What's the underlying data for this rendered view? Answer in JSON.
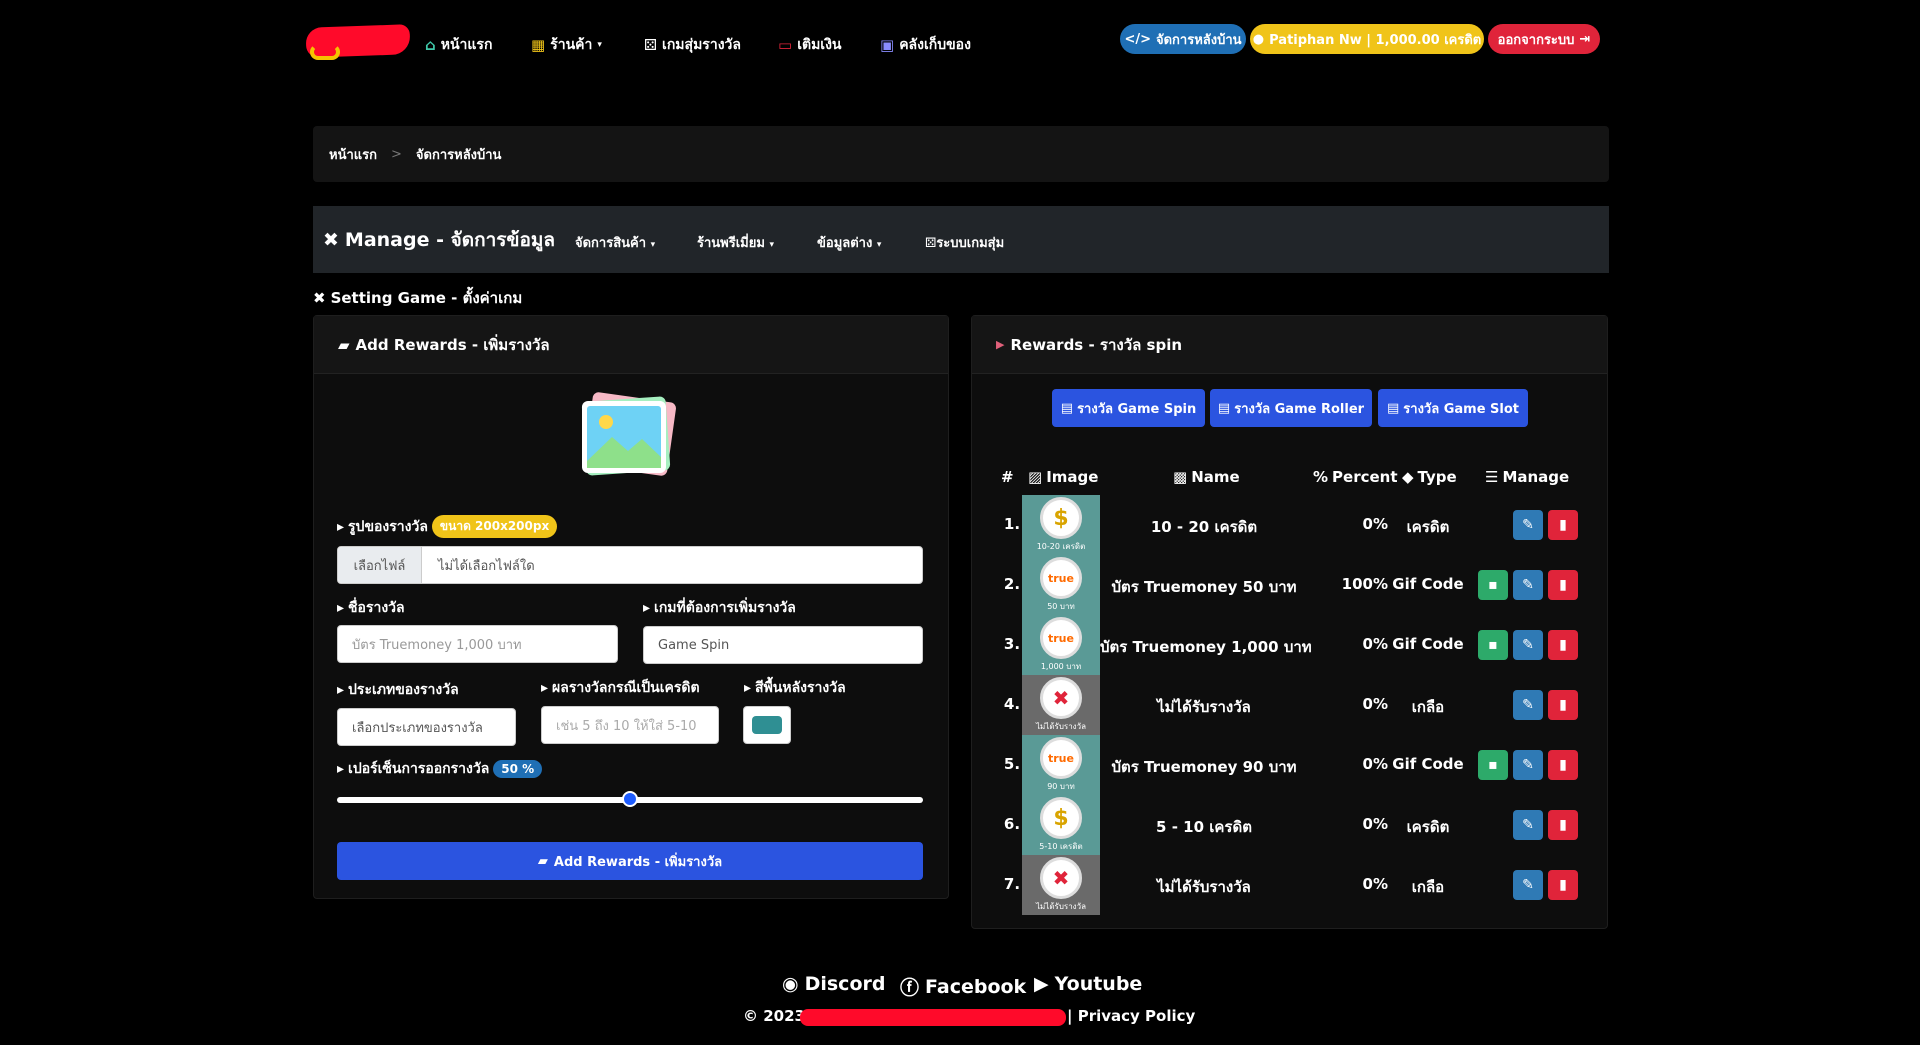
{
  "nav": {
    "home": "หน้าแรก",
    "shop": "ร้านค้า",
    "random_game": "เกมสุ่มรางวัล",
    "topup": "เติมเงิน",
    "inventory": "คลังเก็บของ",
    "admin_pill": "จัดการหลังบ้าน",
    "user_pill": "Patiphan Nw | 1,000.00 เครดิต",
    "logout_pill": "ออกจากระบบ"
  },
  "breadcrumb": {
    "home": "หน้าแรก",
    "sep": ">",
    "current": "จัดการหลังบ้าน"
  },
  "manage_bar": {
    "title": "Manage - จัดการข้อมูล",
    "items": [
      "จัดการสินค้า",
      "ร้านพรีเมี่ยม",
      "ข้อมูลต่าง",
      "ระบบเกมสุ่ม"
    ]
  },
  "setting_title": "Setting Game - ตั้งค่าเกม",
  "add_card": {
    "header": "Add Rewards - เพิ่มรางวัล",
    "image_label": "รูปของรางวัล",
    "image_size_badge": "ขนาด 200x200px",
    "file_button": "เลือกไฟล์",
    "file_value": "ไม่ได้เลือกไฟล์ใด",
    "name_label": "ชื่อรางวัล",
    "name_placeholder": "บัตร Truemoney 1,000 บาท",
    "game_label": "เกมที่ต้องการเพิ่มรางวัล",
    "game_value": "Game Spin",
    "type_label": "ประเภทของรางวัล",
    "type_value": "เลือกประเภทของรางวัล",
    "credit_label": "ผลรางวัลกรณีเป็นเครดิต",
    "credit_placeholder": "เช่น 5 ถึง 10 ให้ใส่ 5-10",
    "bg_label": "สีพื้นหลังรางวัล",
    "bg_color": "#2f8f93",
    "percent_label": "เปอร์เซ็นการออกรางวัล",
    "percent_badge": "50 %",
    "percent_value": 0.5,
    "submit_label": "Add Rewards - เพิ่มรางวัล"
  },
  "rewards_card": {
    "header": "Rewards - รางวัล spin",
    "tabs": [
      "รางวัล Game Spin",
      "รางวัล Game Roller",
      "รางวัล Game Slot"
    ],
    "columns": {
      "num": "#",
      "image": "Image",
      "name": "Name",
      "percent": "Percent",
      "type": "Type",
      "manage": "Manage"
    },
    "rows": [
      {
        "num": "1.",
        "name": "10 - 20 เครดิต",
        "percent": "0%",
        "type": "เครดิต",
        "img_caption": "10-20 เครดิต",
        "icon": "money-bag-icon"
      },
      {
        "num": "2.",
        "name": "บัตร Truemoney 50 บาท",
        "percent": "100%",
        "type": "Gif Code",
        "img_caption": "50 บาท",
        "icon": "truemoney-icon"
      },
      {
        "num": "3.",
        "name": "บัตร Truemoney 1,000 บาท",
        "percent": "0%",
        "type": "Gif Code",
        "img_caption": "1,000 บาท",
        "icon": "truemoney-icon"
      },
      {
        "num": "4.",
        "name": "ไม่ได้รับรางวัล",
        "percent": "0%",
        "type": "เกลือ",
        "img_caption": "ไม่ได้รับรางวัล",
        "icon": "x-icon"
      },
      {
        "num": "5.",
        "name": "บัตร Truemoney 90 บาท",
        "percent": "0%",
        "type": "Gif Code",
        "img_caption": "90 บาท",
        "icon": "truemoney-icon"
      },
      {
        "num": "6.",
        "name": "5 - 10 เครดิต",
        "percent": "0%",
        "type": "เครดิต",
        "img_caption": "5-10 เครดิต",
        "icon": "money-bag-icon"
      },
      {
        "num": "7.",
        "name": "ไม่ได้รับรางวัล",
        "percent": "0%",
        "type": "เกลือ",
        "img_caption": "ไม่ได้รับรางวัล",
        "icon": "x-icon"
      }
    ]
  },
  "footer": {
    "discord": "Discord",
    "facebook": "Facebook",
    "youtube": "Youtube",
    "copyright": "© 2023 -",
    "privacy": "| Privacy Policy"
  }
}
